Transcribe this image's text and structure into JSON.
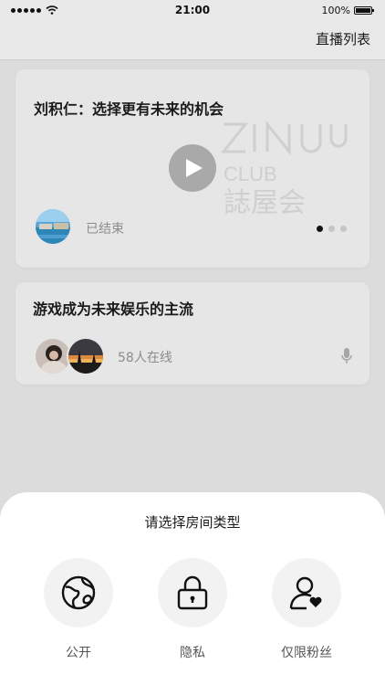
{
  "status_bar": {
    "time": "21:00",
    "battery_text": "100%"
  },
  "nav": {
    "right_link": "直播列表"
  },
  "cards": [
    {
      "title": "刘积仁：选择更有未来的机会",
      "status": "已结束",
      "watermark": {
        "club_text": "CLUB",
        "brand_text": "誌屋会"
      },
      "pager": {
        "total": 3,
        "active_index": 0
      },
      "icons": [
        "play-icon"
      ]
    },
    {
      "title": "游戏成为未来娱乐的主流",
      "status": "58人在线",
      "icons": [
        "mic-icon"
      ]
    }
  ],
  "sheet": {
    "title": "请选择房间类型",
    "options": [
      {
        "label": "公开",
        "icon": "globe-icon"
      },
      {
        "label": "隐私",
        "icon": "lock-icon"
      },
      {
        "label": "仅限粉丝",
        "icon": "user-heart-icon"
      }
    ]
  },
  "colors": {
    "page_background": "#dcdcdc",
    "card_background": "#e6e6e6",
    "sheet_background": "#ffffff",
    "muted_text": "#8c8c8c",
    "pager_active": "#111111"
  }
}
